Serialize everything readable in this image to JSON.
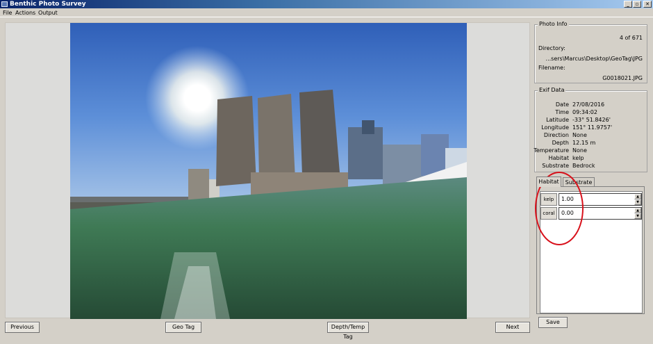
{
  "window": {
    "title": "Benthic Photo Survey",
    "controls": [
      "_",
      "▫",
      "✕"
    ]
  },
  "menu": [
    "File",
    "Actions",
    "Output"
  ],
  "buttons": {
    "previous": "Previous",
    "geo_tag": "Geo Tag",
    "depth_temp_tag": "Depth/Temp Tag",
    "next": "Next",
    "save": "Save"
  },
  "photo_info": {
    "title": "Photo Info",
    "counter": "4 of 671",
    "directory_label": "Directory:",
    "directory_value": "...sers\\Marcus\\Desktop\\GeoTag\\JPG",
    "filename_label": "Filename:",
    "filename_value": "G0018021.JPG"
  },
  "exif": {
    "title": "Exif Data",
    "rows": [
      {
        "label": "Date",
        "value": "27/08/2016"
      },
      {
        "label": "Time",
        "value": "09:34:02"
      },
      {
        "label": "Latitude",
        "value": "-33° 51.8426'"
      },
      {
        "label": "Longitude",
        "value": "151° 11.9757'"
      },
      {
        "label": "Direction",
        "value": "None"
      },
      {
        "label": "Depth",
        "value": "12.15 m"
      },
      {
        "label": "Temperature",
        "value": "None"
      },
      {
        "label": "Habitat",
        "value": "kelp"
      },
      {
        "label": "Substrate",
        "value": "Bedrock"
      }
    ]
  },
  "tabs": [
    {
      "label": "Habitat",
      "active": true
    },
    {
      "label": "Substrate",
      "active": false
    }
  ],
  "habitat_entries": [
    {
      "label": "kelp",
      "value": "1.00"
    },
    {
      "label": "coral",
      "value": "0.00"
    }
  ],
  "colors": {
    "annotation": "#d8101a",
    "titlebar_start": "#0a246a",
    "titlebar_end": "#a6caf0"
  },
  "icons": {
    "spin_up": "▲",
    "spin_down": "▼"
  }
}
